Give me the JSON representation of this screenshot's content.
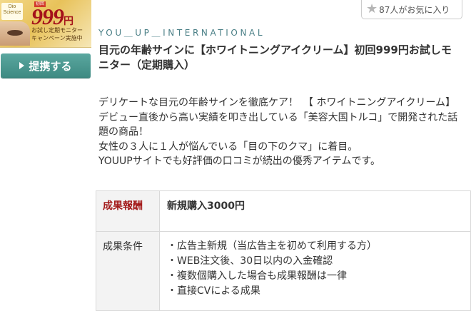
{
  "banner": {
    "brand_text": "Dio Science",
    "tag": "初回",
    "price": "999",
    "yen": "円",
    "line1": "お試し定期モニター",
    "line2": "キャンペーン実施中"
  },
  "tie_button": {
    "label": "提携する"
  },
  "favorite": {
    "label": "87人がお気に入り"
  },
  "company": "YOU＿UP＿INTERNATIONAL",
  "title": "目元の年齢サインに【ホワイトニングアイクリーム】初回999円お試しモニター（定期購入）",
  "description": [
    "デリケートな目元の年齢サインを徹底ケア！　【 ホワイトニングアイクリーム】",
    "デビュー直後から高い実績を叩き出している「美容大国トルコ」で開発された話題の商品！",
    "女性の３人に１人が悩んでいる「目の下のクマ」に着目。",
    "YOUUPサイトでも好評価の口コミが続出の優秀アイテムです。"
  ],
  "reward_table": {
    "reward_label": "成果報酬",
    "reward_value": "新規購入3000円",
    "condition_label": "成果条件",
    "conditions": [
      "・広告主新規（当広告主を初めて利用する方）",
      "・WEB注文後、30日以内の入金確認",
      "・複数個購入した場合も成果報酬は一律",
      "・直接CVによる成果"
    ]
  }
}
